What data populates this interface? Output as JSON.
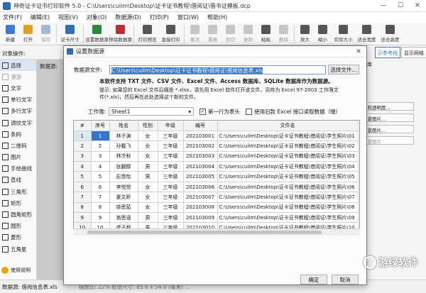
{
  "titlebar": {
    "title": "神奇证卡证书打印软件 5.0 - C:\\Users\\cuilm\\Desktop\\证卡证书教程\\借阅证\\借书证模板.dcp"
  },
  "window_controls": [
    "—",
    "☐",
    "✕"
  ],
  "menu": [
    "文件(F)",
    "编辑(E)",
    "视图(V)",
    "对象(O)",
    "数据源(D)",
    "打印(P)",
    "窗口(W)",
    "帮助(H)"
  ],
  "toolbar": [
    {
      "label": "新建",
      "icon": "new-icon",
      "color": "#3a7bd5",
      "enabled": true
    },
    {
      "label": "打开",
      "icon": "open-icon",
      "color": "#e0a020",
      "enabled": true
    },
    {
      "label": "保存",
      "icon": "save-icon",
      "color": "#3a6fb0",
      "enabled": false
    },
    {
      "label": "证卡尺寸",
      "icon": "card-size-icon",
      "color": "#2f6fb8",
      "enabled": true
    },
    {
      "label": "设置数据源",
      "icon": "set-datasource-icon",
      "color": "#2a8a3a",
      "enabled": true
    },
    {
      "label": "移除数据源",
      "icon": "remove-datasource-icon",
      "color": "#c03030",
      "enabled": true
    },
    {
      "label": "打印预览",
      "icon": "print-preview-icon",
      "color": "#555555",
      "enabled": true
    },
    {
      "label": "直接打印",
      "icon": "print-icon",
      "color": "#555555",
      "enabled": true
    },
    {
      "label": "撤消",
      "icon": "undo-icon",
      "color": "#888888",
      "enabled": false
    },
    {
      "label": "重做",
      "icon": "redo-icon",
      "color": "#888888",
      "enabled": false
    },
    {
      "label": "剪切",
      "icon": "cut-icon",
      "color": "#888888",
      "enabled": false
    },
    {
      "label": "复制",
      "icon": "copy-icon",
      "color": "#888888",
      "enabled": false
    },
    {
      "label": "粘贴",
      "icon": "paste-icon",
      "color": "#555555",
      "enabled": true
    },
    {
      "label": "删除",
      "icon": "delete-icon",
      "color": "#888888",
      "enabled": false
    },
    {
      "label": "放大",
      "icon": "zoom-in-icon",
      "color": "#555555",
      "enabled": true
    },
    {
      "label": "缩小",
      "icon": "zoom-out-icon",
      "color": "#555555",
      "enabled": true
    },
    {
      "label": "实际大小",
      "icon": "actual-size-icon",
      "color": "#555555",
      "enabled": true
    },
    {
      "label": "适合宽度",
      "icon": "fit-width-icon",
      "color": "#555555",
      "enabled": true
    },
    {
      "label": "适合高度",
      "icon": "fit-height-icon",
      "color": "#555555",
      "enabled": true
    }
  ],
  "object_ops_label": "对象操作:",
  "canvas_tab_label": "数据源:",
  "left_panel": [
    {
      "label": "选择",
      "icon": "pointer-icon",
      "selected": true,
      "enabled": true
    },
    {
      "label": "漫游",
      "icon": "hand-icon",
      "selected": false,
      "enabled": false
    },
    {
      "label": "文字",
      "icon": "text-icon",
      "selected": false,
      "enabled": true
    },
    {
      "label": "单行文字",
      "icon": "single-line-text-icon",
      "selected": false,
      "enabled": true
    },
    {
      "label": "多行文字",
      "icon": "multi-line-text-icon",
      "selected": false,
      "enabled": true
    },
    {
      "label": "调纹文字",
      "icon": "arc-text-icon",
      "selected": false,
      "enabled": true
    },
    {
      "label": "条码",
      "icon": "barcode-icon",
      "selected": false,
      "enabled": true
    },
    {
      "label": "二维码",
      "icon": "qrcode-icon",
      "selected": false,
      "enabled": true
    },
    {
      "label": "图片",
      "icon": "image-icon",
      "selected": false,
      "enabled": true
    },
    {
      "label": "手绘曲线",
      "icon": "freehand-icon",
      "selected": false,
      "enabled": true
    },
    {
      "label": "直线",
      "icon": "line-icon",
      "selected": false,
      "enabled": true
    },
    {
      "label": "三角形",
      "icon": "triangle-icon",
      "selected": false,
      "enabled": true
    },
    {
      "label": "矩形",
      "icon": "rectangle-icon",
      "selected": false,
      "enabled": true
    },
    {
      "label": "圆角矩形",
      "icon": "rounded-rect-icon",
      "selected": false,
      "enabled": true
    },
    {
      "label": "圆形",
      "icon": "circle-icon",
      "selected": false,
      "enabled": true
    },
    {
      "label": "菱形",
      "icon": "diamond-icon",
      "selected": false,
      "enabled": true
    },
    {
      "label": "五角星",
      "icon": "star-icon",
      "selected": false,
      "enabled": true
    }
  ],
  "help_label": "使用说明",
  "right_panel": {
    "tabs": [
      "示参考线",
      "显示网格"
    ],
    "section": "素材库",
    "buttons": [
      {
        "label": "片和透明度...",
        "enabled": true
      },
      {
        "label": "背景图片...",
        "enabled": true
      },
      {
        "label": "背景图片...",
        "enabled": true
      },
      {
        "label": "背景图片",
        "enabled": false
      }
    ]
  },
  "status": {
    "text": "数据源: 借阅信息表.xls",
    "more": "缩放比: 22%   纸张尺寸: 85.6 x 54.0 (毫米)   ..."
  },
  "dialog": {
    "title": "设置数据源",
    "close": "✕",
    "source_label": "数据源文件:",
    "source_path": "C:\\Users\\cuilm\\Desktop\\证卡证书教程\\借阅证\\借阅信息表.xls",
    "choose_button": "选择文件...",
    "support_text": "本软件支持 TXT 文件、CSV 文件、Excel 文件、Access 数据库、SQLite 数据库作为数据源。",
    "hint_text": "提示: 如果您的 Excel 文件后缀是 *.xlsx，请先用 Excel 软件打开该文件，另存为 Excel 97-2003 工作簿文件(*.xls)，然后再在此处选择这个新的文件。",
    "sheet_label": "工作簿:",
    "sheet_value": "Sheet1",
    "first_row_header_label": "第一行为表头",
    "first_row_header_checked": true,
    "legacy_excel_label": "使用旧款 Excel 接口读取数据（慢）",
    "legacy_excel_checked": false,
    "columns": [
      "#",
      "序号",
      "姓名",
      "性别",
      "年级",
      "编号",
      "文件名"
    ],
    "rows": [
      [
        "1",
        "1",
        "林子渊",
        "女",
        "三年级",
        "202103001",
        "C:\\Users\\cuilm\\Desktop\\证卡证书教程\\借阅证\\学生照片\\01"
      ],
      [
        "2",
        "2",
        "孙戴飞",
        "女",
        "三年级",
        "202103002",
        "C:\\Users\\cuilm\\Desktop\\证卡证书教程\\借阅证\\学生照片\\02"
      ],
      [
        "3",
        "3",
        "林冷秋",
        "女",
        "三年级",
        "202103003",
        "C:\\Users\\cuilm\\Desktop\\证卡证书教程\\借阅证\\学生照片\\03"
      ],
      [
        "4",
        "4",
        "张翻醇",
        "男",
        "三年级",
        "202103004",
        "C:\\Users\\cuilm\\Desktop\\证卡证书教程\\借阅证\\学生照片\\04"
      ],
      [
        "5",
        "5",
        "彭悠怡",
        "男",
        "三年级",
        "202103005",
        "C:\\Users\\cuilm\\Desktop\\证卡证书教程\\借阅证\\学生照片\\05"
      ],
      [
        "6",
        "6",
        "李悦悦",
        "女",
        "三年级",
        "202103006",
        "C:\\Users\\cuilm\\Desktop\\证卡证书教程\\借阅证\\学生照片\\06"
      ],
      [
        "7",
        "7",
        "夏文昕",
        "女",
        "三年级",
        "202103007",
        "C:\\Users\\cuilm\\Desktop\\证卡证书教程\\借阅证\\学生照片\\07"
      ],
      [
        "8",
        "8",
        "徐思茹",
        "女",
        "三年级",
        "202103008",
        "C:\\Users\\cuilm\\Desktop\\证卡证书教程\\借阅证\\学生照片\\08"
      ],
      [
        "9",
        "9",
        "翁思涵",
        "男",
        "三年级",
        "202103009",
        "C:\\Users\\cuilm\\Desktop\\证卡证书教程\\借阅证\\学生照片\\09"
      ],
      [
        "10",
        "10",
        "虎子超",
        "男",
        "三年级",
        "202103010",
        "C:\\Users\\cuilm\\Desktop\\证卡证书教程\\借阅证\\学生照片\\10"
      ]
    ],
    "ok_button": "确定",
    "cancel_button": "取消"
  },
  "watermark": "游绿软件",
  "accent_color": "#3377cc"
}
